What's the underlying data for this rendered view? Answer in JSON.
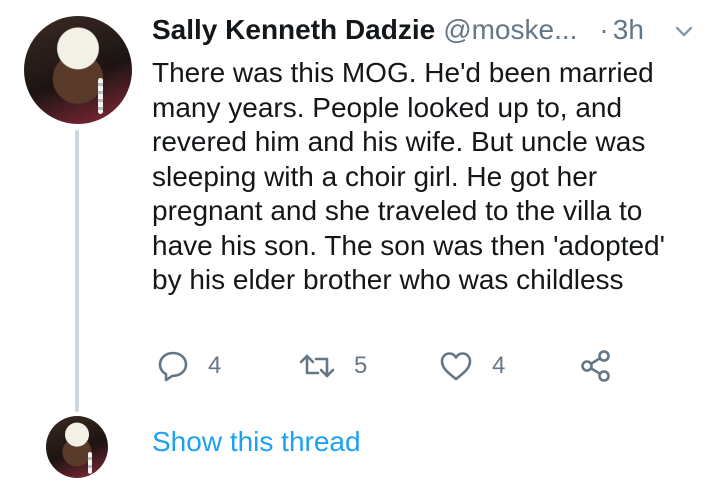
{
  "tweet": {
    "author_name": "Sally Kenneth Dadzie",
    "handle": "@moske...",
    "separator": "·",
    "time": "3h",
    "text_lines": [
      "There was this MOG. He'd been married",
      "many years. People looked up to, and",
      "revered him and his wife. But uncle was",
      "sleeping with a choir girl. He got her",
      "pregnant and she traveled to the villa to",
      "have his son. The son was then 'adopted'",
      "by his elder brother who was childless"
    ],
    "actions": {
      "reply_count": "4",
      "retweet_count": "5",
      "like_count": "4"
    }
  },
  "thread": {
    "show_label": "Show this thread"
  },
  "icons": {
    "reply": "reply-icon",
    "retweet": "retweet-icon",
    "like": "heart-icon",
    "share": "share-icon",
    "menu": "chevron-down-icon"
  },
  "colors": {
    "text": "#14171a",
    "secondary": "#657786",
    "link": "#1da1f2",
    "thread_line": "#ccd6dd"
  }
}
